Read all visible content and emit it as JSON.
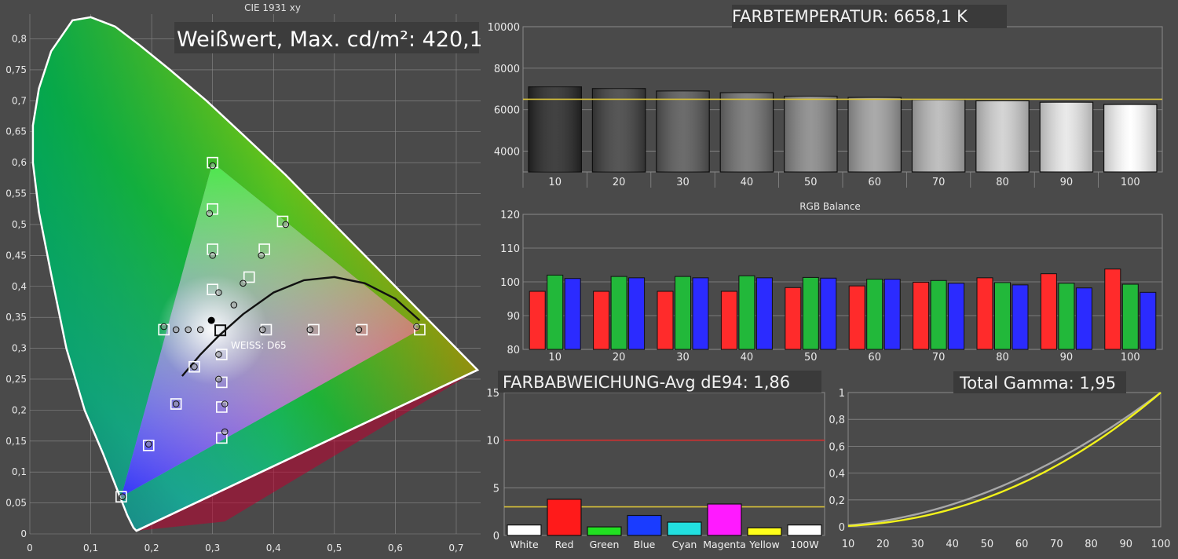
{
  "palette": {
    "background": "#4a4a4a",
    "grid": "#8a8a8a",
    "target_line": "#d8c23a",
    "red": "#ff2b2b",
    "green": "#22b83a",
    "blue": "#2b2bff",
    "gamma_measured": "#f2f21a",
    "gamma_reference": "#a8a8a8",
    "limit_line": "#d23030"
  },
  "cie": {
    "title": "CIE 1931 xy",
    "headline": "Weißwert, Max. cd/m²: 420,1",
    "white_label": "WEISS: D65"
  },
  "colortemp": {
    "headline": "FARBTEMPERATUR: 6658,1 K"
  },
  "rgb": {
    "title": "RGB Balance"
  },
  "deltae": {
    "headline": "FARBABWEICHUNG-Avg dE94: 1,86"
  },
  "gamma": {
    "headline": "Total Gamma: 1,95"
  },
  "chart_data": [
    {
      "type": "scatter",
      "title": "CIE 1931 xy",
      "x_ticks": [
        "0",
        "0,1",
        "0,2",
        "0,3",
        "0,4",
        "0,5",
        "0,6",
        "0,7"
      ],
      "y_ticks": [
        "0",
        "0,05",
        "0,1",
        "0,15",
        "0,2",
        "0,25",
        "0,3",
        "0,35",
        "0,4",
        "0,45",
        "0,5",
        "0,55",
        "0,6",
        "0,65",
        "0,7",
        "0,75",
        "0,8"
      ],
      "xlim": [
        0,
        0.74
      ],
      "ylim": [
        0,
        0.84
      ],
      "gamut_triangle": [
        [
          0.64,
          0.33
        ],
        [
          0.3,
          0.6
        ],
        [
          0.15,
          0.06
        ]
      ],
      "white_point": [
        0.3127,
        0.329
      ],
      "measured_white": [
        0.298,
        0.345
      ],
      "targets": [
        [
          0.64,
          0.33
        ],
        [
          0.545,
          0.33
        ],
        [
          0.466,
          0.33
        ],
        [
          0.388,
          0.33
        ],
        [
          0.3,
          0.6
        ],
        [
          0.3,
          0.525
        ],
        [
          0.3,
          0.46
        ],
        [
          0.3,
          0.395
        ],
        [
          0.415,
          0.505
        ],
        [
          0.385,
          0.46
        ],
        [
          0.36,
          0.415
        ],
        [
          0.22,
          0.33
        ],
        [
          0.24,
          0.21
        ],
        [
          0.27,
          0.27
        ],
        [
          0.195,
          0.143
        ],
        [
          0.15,
          0.06
        ],
        [
          0.315,
          0.155
        ],
        [
          0.315,
          0.205
        ],
        [
          0.315,
          0.245
        ],
        [
          0.315,
          0.29
        ]
      ],
      "measured": [
        [
          0.635,
          0.335
        ],
        [
          0.54,
          0.33
        ],
        [
          0.46,
          0.33
        ],
        [
          0.382,
          0.33
        ],
        [
          0.3,
          0.595
        ],
        [
          0.295,
          0.518
        ],
        [
          0.3,
          0.45
        ],
        [
          0.31,
          0.39
        ],
        [
          0.42,
          0.5
        ],
        [
          0.38,
          0.45
        ],
        [
          0.35,
          0.405
        ],
        [
          0.335,
          0.37
        ],
        [
          0.22,
          0.335
        ],
        [
          0.24,
          0.33
        ],
        [
          0.26,
          0.33
        ],
        [
          0.28,
          0.33
        ],
        [
          0.24,
          0.21
        ],
        [
          0.27,
          0.27
        ],
        [
          0.195,
          0.145
        ],
        [
          0.152,
          0.06
        ],
        [
          0.32,
          0.165
        ],
        [
          0.32,
          0.21
        ],
        [
          0.31,
          0.25
        ],
        [
          0.31,
          0.29
        ]
      ]
    },
    {
      "type": "bar",
      "title": "FARBTEMPERATUR: 6658,1 K",
      "categories": [
        "10",
        "20",
        "30",
        "40",
        "50",
        "60",
        "70",
        "80",
        "90",
        "100"
      ],
      "values": [
        7100,
        7020,
        6900,
        6820,
        6650,
        6590,
        6480,
        6430,
        6360,
        6250
      ],
      "target": 6504,
      "y_ticks": [
        "4000",
        "6000",
        "8000",
        "10000"
      ],
      "ylim": [
        3000,
        10000
      ]
    },
    {
      "type": "bar",
      "title": "RGB Balance",
      "categories": [
        "10",
        "20",
        "30",
        "40",
        "50",
        "60",
        "70",
        "80",
        "90",
        "100"
      ],
      "series": [
        {
          "name": "R",
          "values": [
            97.2,
            97.2,
            97.2,
            97.2,
            98.3,
            98.8,
            99.9,
            101.2,
            102.4,
            103.8
          ]
        },
        {
          "name": "G",
          "values": [
            102.0,
            101.6,
            101.6,
            101.8,
            101.3,
            100.8,
            100.4,
            99.8,
            99.6,
            99.3
          ]
        },
        {
          "name": "B",
          "values": [
            101.0,
            101.2,
            101.2,
            101.2,
            101.1,
            100.8,
            99.6,
            99.1,
            98.2,
            96.9
          ]
        }
      ],
      "y_ticks": [
        "80",
        "90",
        "100",
        "110",
        "120"
      ],
      "ylim": [
        80,
        120
      ]
    },
    {
      "type": "bar",
      "title": "FARBABWEICHUNG-Avg dE94: 1,86",
      "categories": [
        "White",
        "Red",
        "Green",
        "Blue",
        "Cyan",
        "Magenta",
        "Yellow",
        "100W"
      ],
      "values": [
        1.1,
        3.8,
        0.9,
        2.1,
        1.4,
        3.3,
        0.8,
        1.1
      ],
      "colors": [
        "#ffffff",
        "#ff1a1a",
        "#22e022",
        "#1a3cff",
        "#22e0e0",
        "#ff1aff",
        "#ffff1a",
        "#ffffff"
      ],
      "limit_red": 10,
      "limit_yellow": 3,
      "y_ticks": [
        "0",
        "5",
        "10",
        "15"
      ],
      "ylim": [
        0,
        15
      ]
    },
    {
      "type": "line",
      "title": "Total Gamma: 1,95",
      "x_ticks": [
        "10",
        "20",
        "30",
        "40",
        "50",
        "60",
        "70",
        "80",
        "90",
        "100"
      ],
      "y_ticks": [
        "0",
        "0,2",
        "0,4",
        "0,6",
        "0,8",
        "1"
      ],
      "xlim": [
        10,
        100
      ],
      "ylim": [
        0,
        1
      ],
      "series": [
        {
          "name": "reference",
          "gamma": 1.95
        },
        {
          "name": "measured",
          "gamma": 2.2
        }
      ]
    }
  ]
}
